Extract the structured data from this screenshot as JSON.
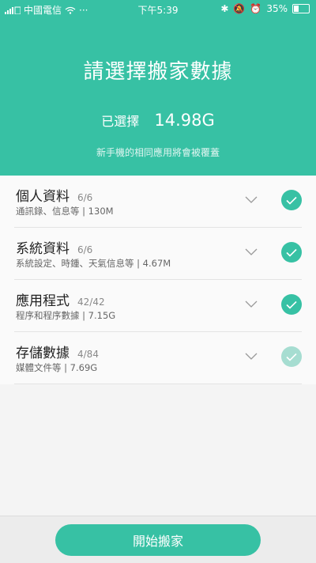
{
  "status_bar": {
    "carrier": "中國電信",
    "time": "下午5:39",
    "battery": "35%",
    "battery_level": 0.35
  },
  "header": {
    "title": "請選擇搬家數據",
    "selected_label": "已選擇",
    "selected_size": "14.98G",
    "notice": "新手機的相同應用將會被覆蓋"
  },
  "items": [
    {
      "name": "個人資料",
      "count": "6/6",
      "detail": "通訊錄、信息等 | 130M",
      "checked": true
    },
    {
      "name": "系統資料",
      "count": "6/6",
      "detail": "系統設定、時鍾、天氣信息等 | 4.67M",
      "checked": true
    },
    {
      "name": "應用程式",
      "count": "42/42",
      "detail": "程序和程序數據 | 7.15G",
      "checked": true
    },
    {
      "name": "存儲數據",
      "count": "4/84",
      "detail": "媒體文件等 | 7.69G",
      "checked": "partial"
    }
  ],
  "footer": {
    "start_label": "開始搬家"
  },
  "colors": {
    "accent": "#37c1a4",
    "accent_light": "#a6ddd1"
  }
}
